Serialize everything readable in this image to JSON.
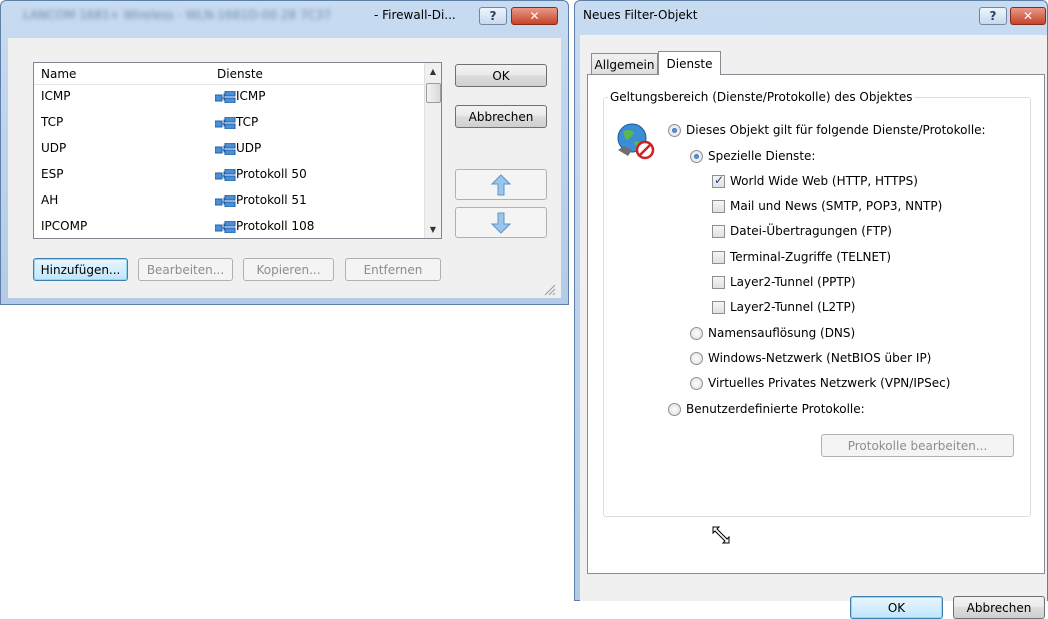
{
  "dialog1": {
    "title_prefix": "LANCOM 1681+ Wireless - WLN-1681D-00 28 7C37",
    "title_suffix": "- Firewall-Di...",
    "help_label": "?",
    "close_label": "✕",
    "list": {
      "columns": [
        "Name",
        "Dienste"
      ],
      "rows": [
        {
          "name": "ICMP",
          "service": "ICMP"
        },
        {
          "name": "TCP",
          "service": "TCP"
        },
        {
          "name": "UDP",
          "service": "UDP"
        },
        {
          "name": "ESP",
          "service": "Protokoll 50"
        },
        {
          "name": "AH",
          "service": "Protokoll 51"
        },
        {
          "name": "IPCOMP",
          "service": "Protokoll 108"
        }
      ]
    },
    "ok_label": "OK",
    "cancel_label": "Abbrechen",
    "add_label": "Hinzufügen...",
    "edit_label": "Bearbeiten...",
    "copy_label": "Kopieren...",
    "remove_label": "Entfernen"
  },
  "dialog2": {
    "title": "Neues Filter-Objekt",
    "help_label": "?",
    "close_label": "✕",
    "tabs": [
      "Allgemein",
      "Dienste"
    ],
    "group_title": "Geltungsbereich (Dienste/Protokolle) des Objektes",
    "radio_main": "Dieses Objekt gilt für folgende Dienste/Protokolle:",
    "radio_special": "Spezielle Dienste:",
    "checkboxes": [
      {
        "label": "World Wide Web (HTTP, HTTPS)",
        "checked": true
      },
      {
        "label": "Mail und News (SMTP, POP3, NNTP)",
        "checked": false
      },
      {
        "label": "Datei-Übertragungen (FTP)",
        "checked": false
      },
      {
        "label": "Terminal-Zugriffe (TELNET)",
        "checked": false
      },
      {
        "label": "Layer2-Tunnel (PPTP)",
        "checked": false
      },
      {
        "label": "Layer2-Tunnel (L2TP)",
        "checked": false
      }
    ],
    "radio_dns": "Namensauflösung (DNS)",
    "radio_netbios": "Windows-Netzwerk (NetBIOS über IP)",
    "radio_vpn": "Virtuelles Privates Netzwerk (VPN/IPSec)",
    "radio_custom": "Benutzerdefinierte Protokolle:",
    "edit_protocols_label": "Protokolle bearbeiten...",
    "ok_label": "OK",
    "cancel_label": "Abbrechen"
  },
  "colors": {
    "title_frame": "#b9d1ea",
    "close_red": "#c5432a",
    "checkmark": "#1e3f8a"
  }
}
